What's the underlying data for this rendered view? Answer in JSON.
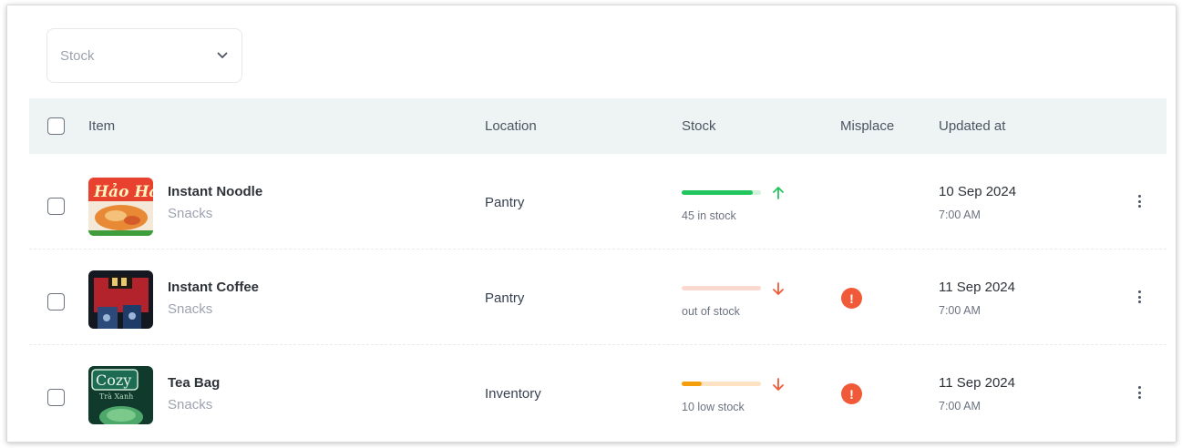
{
  "filter": {
    "label": "Stock"
  },
  "table": {
    "columns": [
      "Item",
      "Location",
      "Stock",
      "Misplace",
      "Updated at"
    ],
    "rows": [
      {
        "name": "Instant Noodle",
        "category": "Snacks",
        "location": "Pantry",
        "stock_text": "45 in stock",
        "stock_level": 0.9,
        "stock_trend": "up",
        "misplaced": false,
        "date": "10 Sep 2024",
        "time": "7:00 AM"
      },
      {
        "name": "Instant Coffee",
        "category": "Snacks",
        "location": "Pantry",
        "stock_text": "out of stock",
        "stock_level": 0,
        "stock_trend": "down",
        "misplaced": true,
        "date": "11 Sep 2024",
        "time": "7:00 AM"
      },
      {
        "name": "Tea Bag",
        "category": "Snacks",
        "location": "Inventory",
        "stock_text": "10 low stock",
        "stock_level": 0.25,
        "stock_trend": "down",
        "misplaced": true,
        "date": "11 Sep 2024",
        "time": "7:00 AM"
      }
    ]
  },
  "colors": {
    "header_bg": "#eef4f3",
    "stock_good": "#22c55e",
    "stock_good_track": "#d1f2dc",
    "stock_bad": "#f05a38",
    "stock_bad_track": "#fbd9cf",
    "stock_low": "#f59e0b",
    "stock_low_track": "#fde3c4"
  },
  "icons": {
    "filter_chevron": "chevron-down-icon",
    "row_menu": "kebab-menu-icon",
    "misplace_warning": "alert-circle-icon",
    "trend_up": "arrow-up-icon",
    "trend_down": "arrow-down-icon"
  }
}
